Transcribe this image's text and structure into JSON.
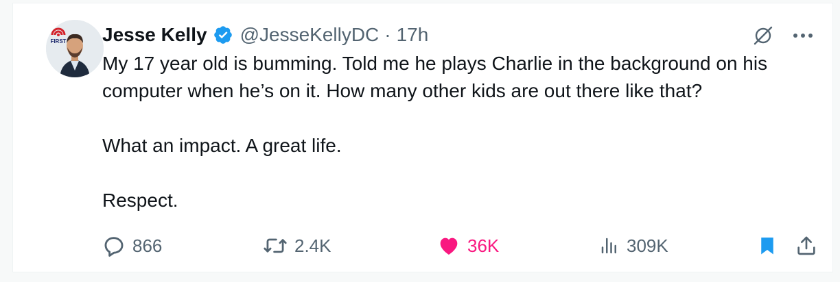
{
  "author": {
    "display_name": "Jesse Kelly",
    "handle": "@JesseKellyDC",
    "separator": "·",
    "time_ago": "17h",
    "avatar_badge_text": "FIRST",
    "verified": true
  },
  "tweet": {
    "paragraphs": [
      "My 17 year old is bumming. Told me he plays Charlie in the background on his computer when he’s on it. How many other kids are out there like that?",
      "What an impact. A great life.",
      "Respect."
    ]
  },
  "actions": {
    "replies": "866",
    "reposts": "2.4K",
    "likes": "36K",
    "views": "309K"
  },
  "icons": {
    "grok": "grok-icon",
    "more": "more-icon",
    "reply": "reply-icon",
    "repost": "repost-icon",
    "like": "heart-icon",
    "views": "views-icon",
    "bookmark": "bookmark-icon",
    "share": "share-icon"
  },
  "colors": {
    "verified": "#1d9bf0",
    "like": "#f91880",
    "bookmark": "#1d9bf0",
    "muted": "#536471",
    "text": "#0f1419"
  }
}
